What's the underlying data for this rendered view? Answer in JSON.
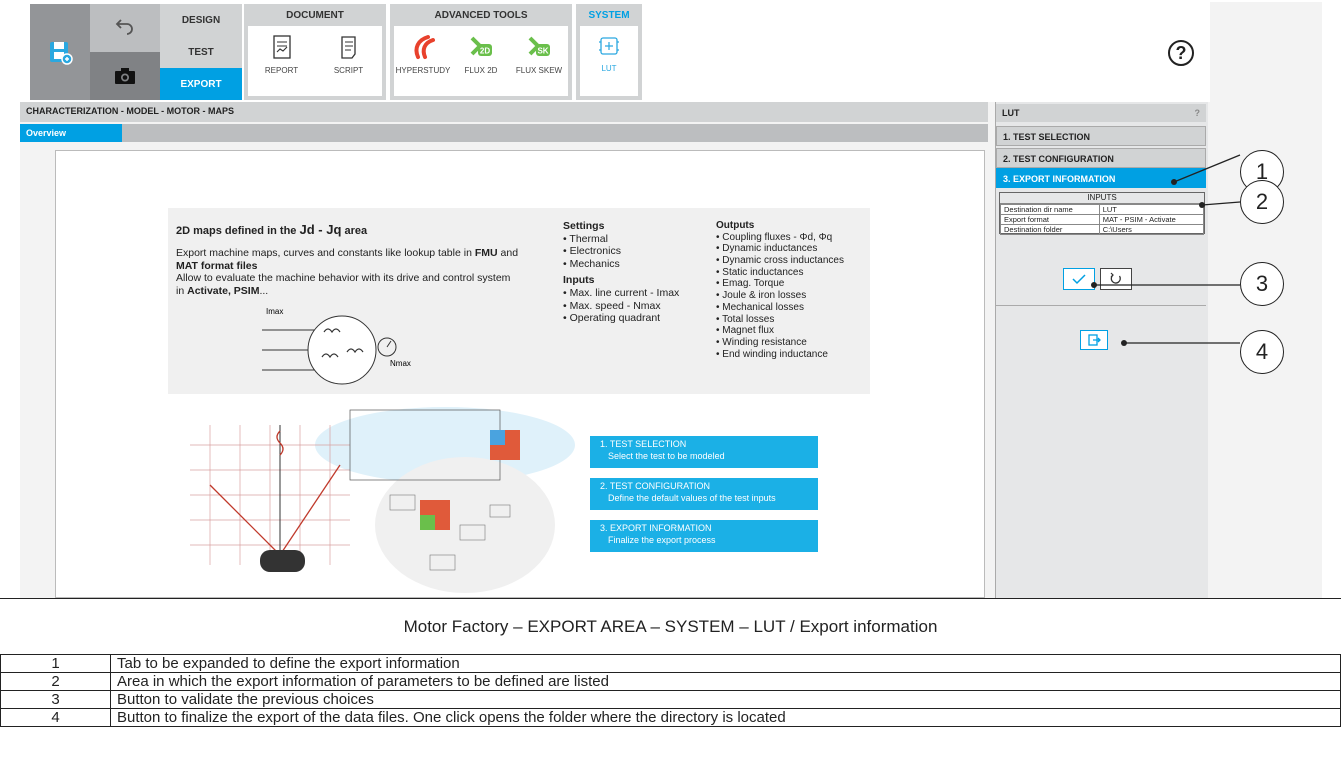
{
  "toolbar": {
    "nav": [
      {
        "label": "DESIGN"
      },
      {
        "label": "TEST"
      },
      {
        "label": "EXPORT"
      }
    ],
    "groups": [
      {
        "title": "DOCUMENT",
        "tools": [
          {
            "label": "REPORT",
            "icon": "report-icon"
          },
          {
            "label": "SCRIPT",
            "icon": "script-icon"
          }
        ]
      },
      {
        "title": "ADVANCED TOOLS",
        "tools": [
          {
            "label": "HYPERSTUDY",
            "icon": "hyperstudy-icon"
          },
          {
            "label": "FLUX 2D",
            "icon": "flux2d-icon",
            "badge": "2D"
          },
          {
            "label": "FLUX SKEW",
            "icon": "fluxskew-icon",
            "badge": "SK"
          }
        ]
      },
      {
        "title": "SYSTEM",
        "tools": [
          {
            "label": "LUT",
            "icon": "lut-icon"
          }
        ]
      }
    ],
    "help": "?"
  },
  "breadcrumb": "CHARACTERIZATION - MODEL - MOTOR - MAPS",
  "tab": "Overview",
  "overview": {
    "heading": "2D maps defined in the",
    "heading_sym": "Jd - Jq",
    "heading_end": "area",
    "desc1": "Export machine maps, curves and constants like lookup table in",
    "fmu": "FMU",
    "and": "and",
    "mat": "MAT format files",
    "desc2": "Allow to evaluate the machine behavior with its drive and control system in",
    "activate": "Activate, PSIM",
    "dots": "...",
    "settings_title": "Settings",
    "settings": [
      "Thermal",
      "Electronics",
      "Mechanics"
    ],
    "inputs_title": "Inputs",
    "inputs": [
      "Max. line current - Imax",
      "Max. speed - Nmax",
      "Operating quadrant"
    ],
    "outputs_title": "Outputs",
    "outputs": [
      "Coupling fluxes - Φd, Φq",
      "Dynamic inductances",
      "Dynamic cross inductances",
      "Static inductances",
      "Emag. Torque",
      "Joule & iron losses",
      "Mechanical losses",
      "Total losses",
      "Magnet flux",
      "Winding resistance",
      "End winding inductance"
    ],
    "diagram_labels": {
      "imax": "Imax",
      "nmax": "Nmax"
    },
    "steps": [
      {
        "title": "1. TEST SELECTION",
        "desc": "Select the test to be modeled"
      },
      {
        "title": "2. TEST CONFIGURATION",
        "desc": "Define the default values of the test inputs"
      },
      {
        "title": "3. EXPORT INFORMATION",
        "desc": "Finalize the export process"
      }
    ]
  },
  "panel": {
    "title": "LUT",
    "help": "?",
    "accordion": [
      "1. TEST SELECTION",
      "2. TEST CONFIGURATION",
      "3. EXPORT INFORMATION"
    ],
    "inputs_title": "INPUTS",
    "rows": [
      {
        "k": "Destination dir name",
        "v": "LUT"
      },
      {
        "k": "Export format",
        "v": "MAT - PSIM - Activate"
      },
      {
        "k": "Destination folder",
        "v": "C:\\Users"
      }
    ]
  },
  "callouts": [
    "1",
    "2",
    "3",
    "4"
  ],
  "caption": "Motor Factory – EXPORT AREA –   SYSTEM – LUT / Export information",
  "legend": [
    {
      "n": "1",
      "text": "Tab to be expanded to define the export information"
    },
    {
      "n": "2",
      "text": "Area in which the export information of parameters to be defined are listed"
    },
    {
      "n": "3",
      "text": "Button to validate the previous choices"
    },
    {
      "n": "4",
      "text": "Button to finalize the export of the data files. One click opens the folder where the directory is located"
    }
  ],
  "colors": {
    "accent": "#00a0e3",
    "steps": "#1bb0e6",
    "toolbar_gray": "#d1d3d4",
    "hyperstudy": "#e8412c",
    "flux_green": "#6abf4b"
  }
}
